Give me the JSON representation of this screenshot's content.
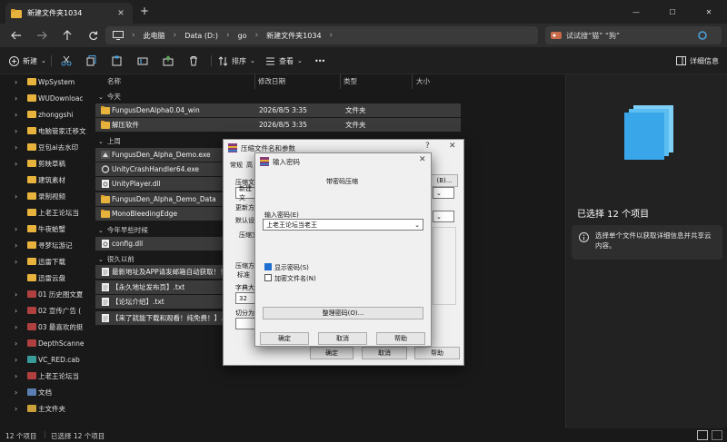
{
  "tab": {
    "title": "新建文件夹1034",
    "new_tab": "+"
  },
  "window": {
    "min": "—",
    "max": "☐",
    "close": "✕"
  },
  "address": {
    "crumbs": [
      "此电脑",
      "Data (D:)",
      "go",
      "新建文件夹1034"
    ],
    "more": "›"
  },
  "search": {
    "text": "试试搜“猫” “狗”"
  },
  "toolbar": {
    "new_label": "新建",
    "sort_label": "排序",
    "view_label": "查看",
    "more": "•••",
    "details_label": "详细信息"
  },
  "sidebar": {
    "items": [
      {
        "label": "WpSystem",
        "color": "#e8b33c",
        "expand": true
      },
      {
        "label": "WUDownloac",
        "color": "#e8b33c",
        "expand": true
      },
      {
        "label": "zhonggshi",
        "color": "#e8b33c",
        "expand": true
      },
      {
        "label": "电脑管家迁移文",
        "color": "#e8b33c",
        "expand": true
      },
      {
        "label": "豆包ai去水印",
        "color": "#e8b33c",
        "expand": true
      },
      {
        "label": "剪映草稿",
        "color": "#e8b33c",
        "expand": true
      },
      {
        "label": "建筑素材",
        "color": "#e8b33c",
        "expand": false
      },
      {
        "label": "录制视频",
        "color": "#e8b33c",
        "expand": true
      },
      {
        "label": "上老王论坛当",
        "color": "#e8b33c",
        "expand": false
      },
      {
        "label": "牛夜蛤蟹",
        "color": "#e8b33c",
        "expand": true
      },
      {
        "label": "寻梦坛游记",
        "color": "#e8b33c",
        "expand": true
      },
      {
        "label": "迅雷下载",
        "color": "#e8b33c",
        "expand": true
      },
      {
        "label": "迅雷云盘",
        "color": "#e8b33c",
        "expand": false
      },
      {
        "label": "01 历史图文夏",
        "color": "#b04040",
        "expand": true
      },
      {
        "label": "02 宣传广告 (",
        "color": "#b04040",
        "expand": true
      },
      {
        "label": "03 最喜欢的挺",
        "color": "#b04040",
        "expand": true
      },
      {
        "label": "DepthScanne",
        "color": "#b04040",
        "expand": true
      },
      {
        "label": "VC_RED.cab",
        "color": "#3a9a9a",
        "expand": true
      },
      {
        "label": "上老王论坛当",
        "color": "#b04040",
        "expand": true
      },
      {
        "label": "文档",
        "color": "#5a7fb0",
        "expand": true
      },
      {
        "label": "主文件夹",
        "color": "#c9a03a",
        "expand": true
      }
    ]
  },
  "columns": {
    "name": "名称",
    "date": "修改日期",
    "type": "类型",
    "size": "大小"
  },
  "groups": {
    "today": "今天",
    "lastweek": "上周",
    "earlier_year": "今年早些时候",
    "long_ago": "很久以前"
  },
  "files": {
    "today": [
      {
        "name": "FungusDenAlpha0.04_win",
        "date": "2026/8/5 3:35",
        "type": "文件夹",
        "icon": "folder"
      },
      {
        "name": "解压软件",
        "date": "2026/8/5 3:35",
        "type": "文件夹",
        "icon": "folder"
      }
    ],
    "lastweek": [
      {
        "name": "FungusDen_Alpha_Demo.exe",
        "icon": "exe"
      },
      {
        "name": "UnityCrashHandler64.exe",
        "icon": "gear"
      },
      {
        "name": "UnityPlayer.dll",
        "icon": "dll"
      },
      {
        "name": "FungusDen_Alpha_Demo_Data",
        "icon": "folder"
      },
      {
        "name": "MonoBleedingEdge",
        "icon": "folder"
      }
    ],
    "earlier_year": [
      {
        "name": "config.dll",
        "icon": "dll"
      }
    ],
    "long_ago": [
      {
        "name": "最新地址及APP请发邮箱自动获取！！",
        "icon": "txt"
      },
      {
        "name": "【永久地址发布页】.txt",
        "icon": "txt"
      },
      {
        "name": "【论坛介绍】.txt",
        "icon": "txt"
      },
      {
        "name": "【来了就能下载和观看！纯免费！】.txt",
        "icon": "txt"
      }
    ]
  },
  "details": {
    "selected": "已选择 12 个项目",
    "hint": "选择单个文件以获取详细信息并共享云内容。"
  },
  "status": {
    "count": "12 个项目",
    "selected": "已选择 12 个项目"
  },
  "dialog1": {
    "title": "压缩文件名和参数",
    "help": "?",
    "tab_general": "常规",
    "tab_advanced": "高",
    "archive_label": "压缩文",
    "archive_value": "新建文",
    "browse": "(B)...",
    "update_label": "更新方",
    "default_label": "默认设",
    "format_label": "压缩文",
    "method_label": "压缩方",
    "method_value": "标准",
    "dict_label": "字典大",
    "dict_value": "32",
    "split_label": "切分为分",
    "ok": "确定",
    "cancel": "取消",
    "helpbtn": "帮助"
  },
  "dialog2": {
    "title": "输入密码",
    "section": "带密码压缩",
    "pw_label": "输入密码(E)",
    "pw_value": "上老王论坛当老王",
    "show_pw": "显示密码(S)",
    "show_pw_checked": true,
    "encrypt_names": "加密文件名(N)",
    "encrypt_names_checked": false,
    "organize": "整理密码(O)...",
    "ok": "确定",
    "cancel": "取消",
    "help": "帮助"
  }
}
